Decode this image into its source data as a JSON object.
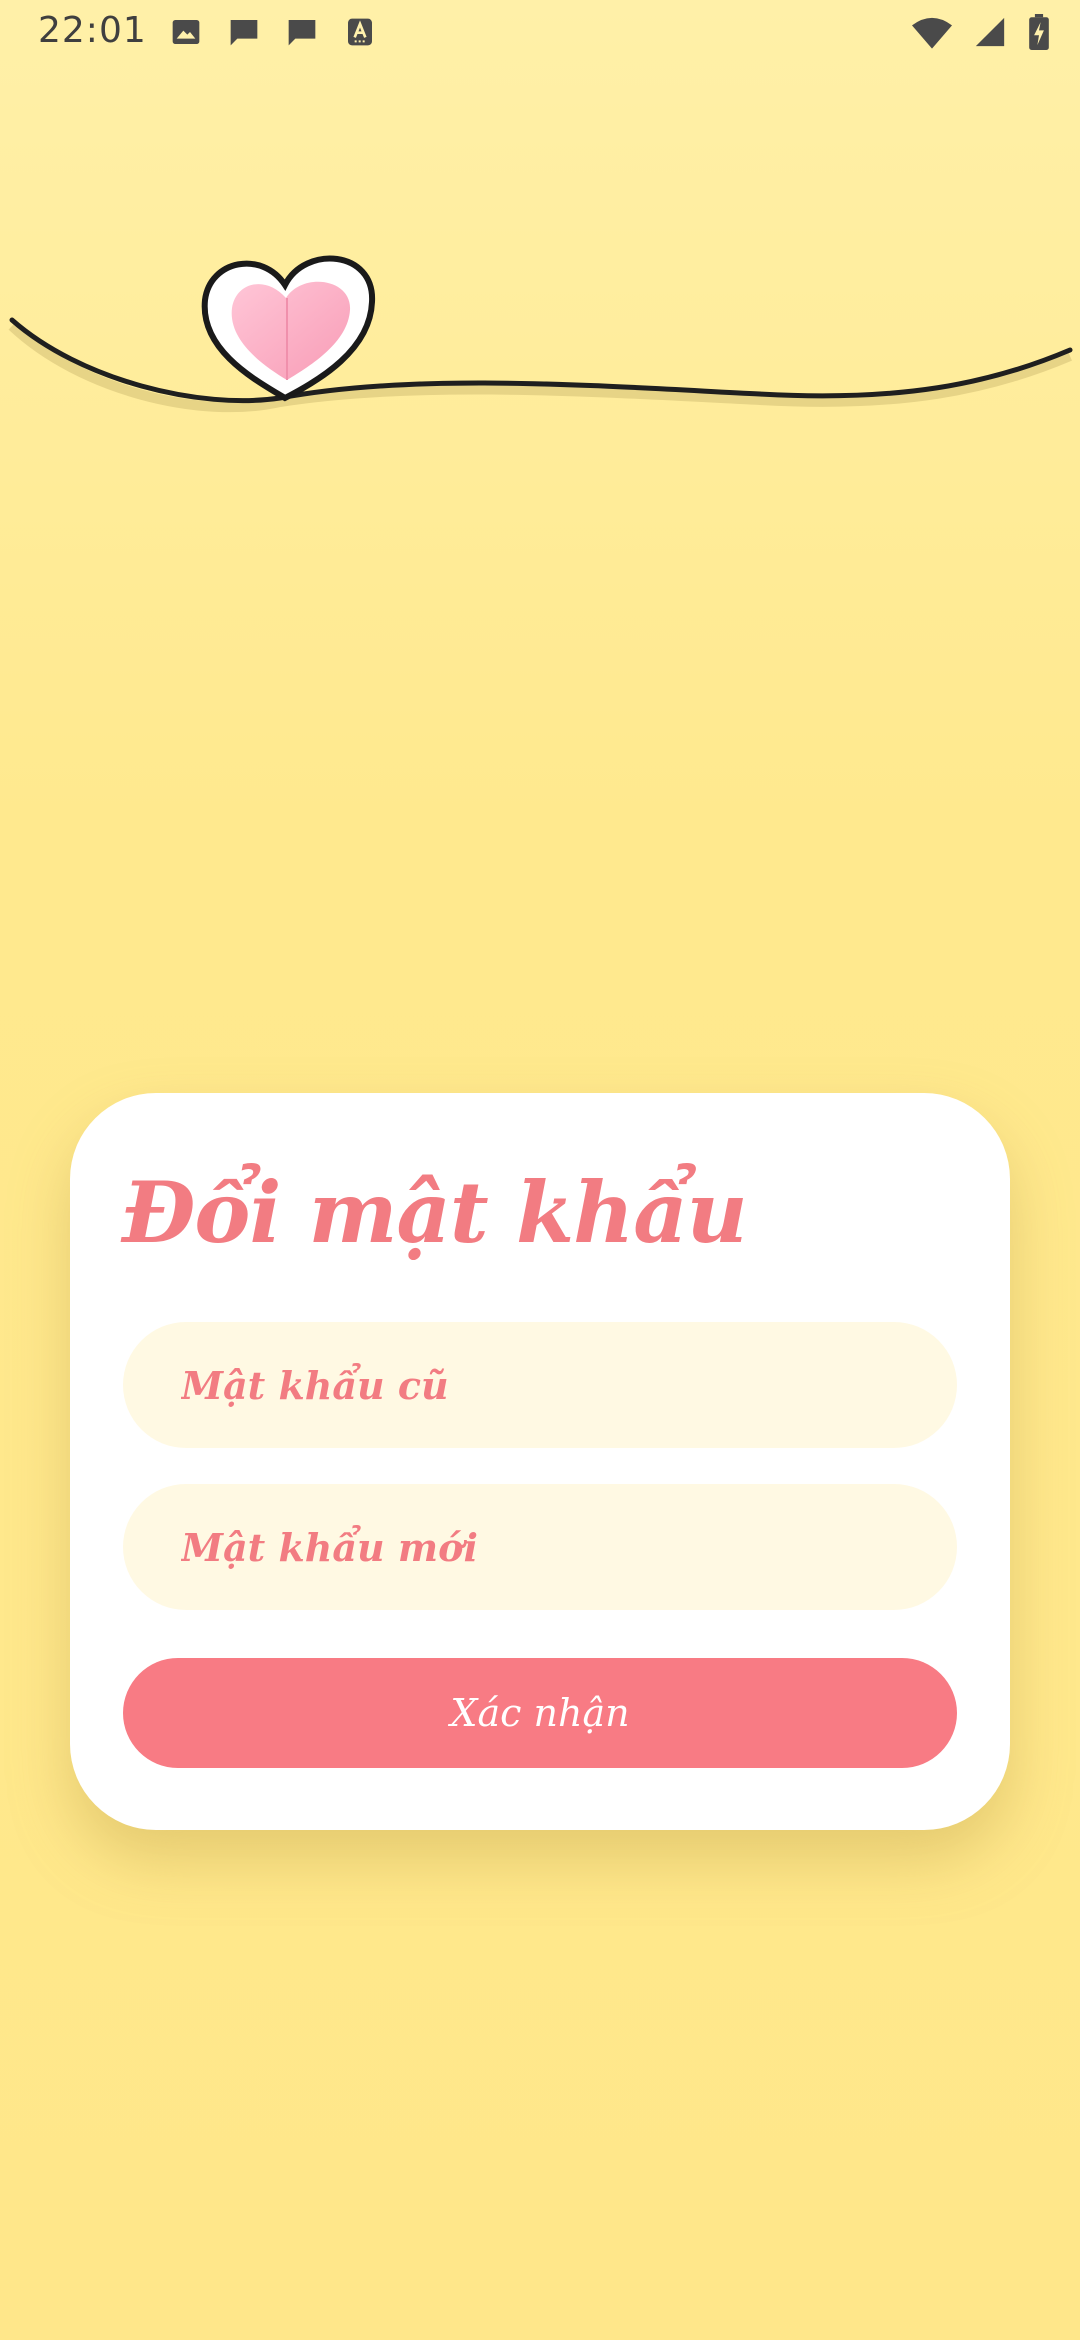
{
  "status_bar": {
    "time": "22:01",
    "left_icons": [
      "image-icon",
      "message-icon",
      "message-icon",
      "text-a-icon"
    ],
    "right_icons": [
      "wifi-icon",
      "signal-icon",
      "battery-charging-icon"
    ]
  },
  "colors": {
    "background_top": "#fff0a8",
    "background_bottom": "#ffe78a",
    "accent_pink": "#f27c82",
    "button_pink": "#f87b84",
    "field_bg": "#fff9e3",
    "card_bg": "#ffffff"
  },
  "card": {
    "title": "Đổi mật khẩu",
    "fields": {
      "old_password": {
        "placeholder": "Mật khẩu cũ",
        "value": ""
      },
      "new_password": {
        "placeholder": "Mật khẩu mới",
        "value": ""
      }
    },
    "confirm_label": "Xác nhận"
  },
  "decoration": {
    "icon": "heart-icon"
  }
}
